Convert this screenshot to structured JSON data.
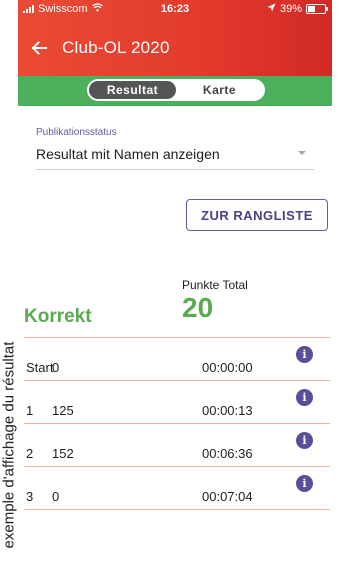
{
  "side_caption": "exemple d'affichage du résultat",
  "status_bar": {
    "carrier": "Swisscom",
    "time": "16:23",
    "battery": "39%"
  },
  "header": {
    "title": "Club-OL 2020"
  },
  "tabs": [
    {
      "label": "Resultat",
      "active": true
    },
    {
      "label": "Karte",
      "active": false
    }
  ],
  "publication": {
    "label": "Publikationsstatus",
    "value": "Resultat mit Namen anzeigen"
  },
  "ranking_button": "ZUR RANGLISTE",
  "summary": {
    "total_label": "Punkte Total",
    "total_value": "20",
    "status": "Korrekt"
  },
  "rows": [
    {
      "id": "Start",
      "points": "0",
      "time": "00:00:00"
    },
    {
      "id": "1",
      "points": "125",
      "time": "00:00:13"
    },
    {
      "id": "2",
      "points": "152",
      "time": "00:06:36"
    },
    {
      "id": "3",
      "points": "0",
      "time": "00:07:04"
    }
  ],
  "colors": {
    "header_red": "#e33c2e",
    "tab_green": "#4caf5c",
    "accent_purple": "#5b4d99",
    "result_green": "#5aab4f",
    "divider_orange": "#efb29c"
  },
  "icons": {
    "back": "arrow-left-icon",
    "info": "info-icon",
    "dropdown": "chevron-down-icon"
  }
}
